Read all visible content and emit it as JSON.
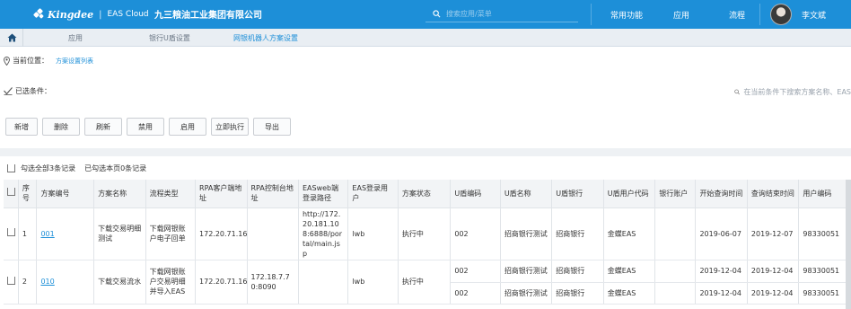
{
  "header": {
    "brand": "Kingdee",
    "product": "EAS Cloud",
    "company": "九三粮油工业集团有限公司",
    "search_placeholder": "搜索应用/菜单",
    "nav": [
      "常用功能",
      "应用",
      "流程"
    ],
    "user": "李文斌"
  },
  "tabs": [
    {
      "label": "应用",
      "active": false
    },
    {
      "label": "银行U盾设置",
      "active": false
    },
    {
      "label": "网银机器人方案设置",
      "active": true
    }
  ],
  "breadcrumb": {
    "label": "当前位置：",
    "current": "方案设置列表"
  },
  "filter": {
    "label": "已选条件：",
    "search_placeholder": "在当前条件下搜索方案名称、EAS"
  },
  "toolbar": [
    "新增",
    "删除",
    "刷新",
    "禁用",
    "启用",
    "立即执行",
    "导出"
  ],
  "selection": {
    "all": "勾选全部3条记录",
    "page": "已勾选本页0条记录"
  },
  "table": {
    "columns": [
      "",
      "序号",
      "方案编号",
      "方案名称",
      "流程类型",
      "RPA客户端地址",
      "RPA控制台地址",
      "EASweb端登录路径",
      "EAS登录用户",
      "方案状态",
      "U盾编码",
      "U盾名称",
      "U盾银行",
      "U盾用户代码",
      "银行账户",
      "开始查询时间",
      "查询结束时间",
      "用户编码"
    ],
    "rows": [
      {
        "index": "1",
        "code": "001",
        "name": "下载交易明细测试",
        "flow": "下载网银账户电子回单",
        "rpa_client": "172.20.71.166",
        "rpa_console": "",
        "eas_url": "http://172.20.181.108:6888/portal/main.jsp",
        "eas_user": "lwb",
        "status": "执行中",
        "ukeys": [
          {
            "code": "002",
            "name": "招商银行测试",
            "bank": "招商银行",
            "user_code": "金蝶EAS",
            "account": "",
            "start": "2019-06-07",
            "end": "2019-12-07",
            "user": "98330051"
          }
        ]
      },
      {
        "index": "2",
        "code": "010",
        "name": "下载交易流水",
        "flow": "下载网银账户交易明细并导入EAS",
        "rpa_client": "172.20.71.166",
        "rpa_console": "172.18.7.70:8090",
        "eas_url": "",
        "eas_user": "lwb",
        "status": "执行中",
        "ukeys": [
          {
            "code": "002",
            "name": "招商银行测试",
            "bank": "招商银行",
            "user_code": "金蝶EAS",
            "account": "",
            "start": "2019-12-04",
            "end": "2019-12-04",
            "user": "98330051"
          },
          {
            "code": "002",
            "name": "招商银行测试",
            "bank": "招商银行",
            "user_code": "金蝶EAS",
            "account": "",
            "start": "2019-12-04",
            "end": "2019-12-04",
            "user": "98330051"
          }
        ]
      }
    ]
  }
}
